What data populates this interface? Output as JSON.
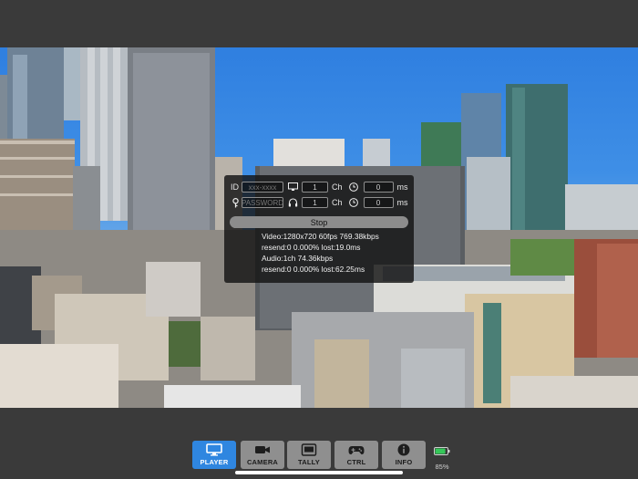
{
  "colors": {
    "accent": "#2f86e0",
    "tab_inactive": "#8f8f8f",
    "battery": "#35c759"
  },
  "panel": {
    "id_label": "ID",
    "id_placeholder": "xxx-xxxx",
    "password_placeholder": "PASSWORD",
    "video_channel_value": "1",
    "audio_channel_value": "1",
    "channel_unit": "Ch",
    "video_delay_value": "0",
    "audio_delay_value": "0",
    "delay_unit": "ms",
    "stop_label": "Stop",
    "stats": [
      "Video:1280x720 60fps 769.38kbps",
      "resend:0 0.000% lost:19.0ms",
      "Audio:1ch 74.36kbps",
      "resend:0 0.000% lost:62.25ms"
    ]
  },
  "tabs": [
    {
      "label": "PLAYER",
      "icon": "monitor-icon",
      "active": true
    },
    {
      "label": "CAMERA",
      "icon": "camera-icon",
      "active": false
    },
    {
      "label": "TALLY",
      "icon": "tally-icon",
      "active": false
    },
    {
      "label": "CTRL",
      "icon": "gamepad-icon",
      "active": false
    },
    {
      "label": "INFO",
      "icon": "info-icon",
      "active": false
    }
  ],
  "battery": {
    "percent_text": "85%",
    "level": 0.85
  }
}
